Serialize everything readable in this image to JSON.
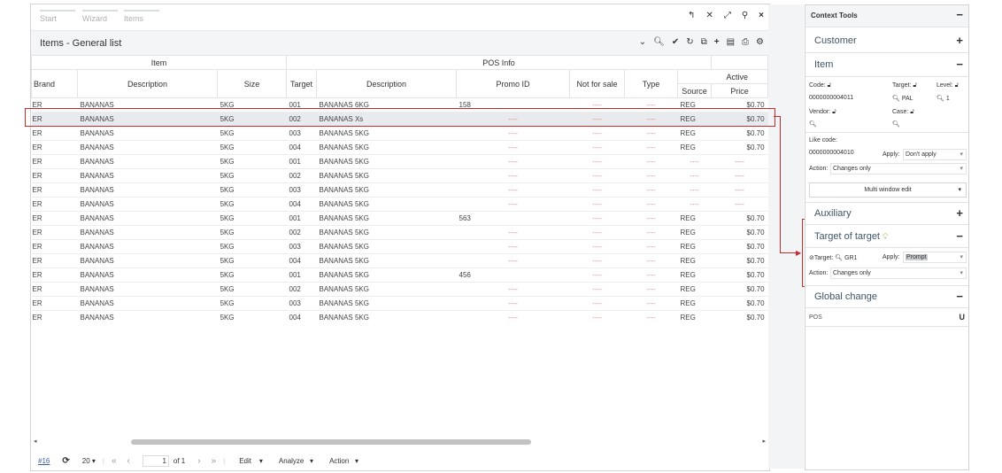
{
  "wizard": {
    "steps": [
      "Start",
      "Wizard",
      "Items"
    ]
  },
  "header": {
    "title": "Items - General list"
  },
  "grid": {
    "groups": [
      "Item",
      "POS Info"
    ],
    "columns": [
      "Brand",
      "Description",
      "Size",
      "Target",
      "Description",
      "Promo ID",
      "Not for sale",
      "Type",
      "Active"
    ],
    "subcolumns": [
      "Source",
      "Price"
    ],
    "rows": [
      [
        "ER",
        "BANANAS",
        "5KG",
        "001",
        "BANANAS 6KG",
        "158",
        "----",
        "----",
        "REG",
        "$0.70"
      ],
      [
        "ER",
        "BANANAS",
        "5KG",
        "002",
        "BANANAS Xs",
        "----",
        "----",
        "----",
        "REG",
        "$0.70"
      ],
      [
        "ER",
        "BANANAS",
        "5KG",
        "003",
        "BANANAS 5KG",
        "----",
        "----",
        "----",
        "REG",
        "$0.70"
      ],
      [
        "ER",
        "BANANAS",
        "5KG",
        "004",
        "BANANAS 5KG",
        "----",
        "----",
        "----",
        "REG",
        "$0.70"
      ],
      [
        "ER",
        "BANANAS",
        "5KG",
        "001",
        "BANANAS 5KG",
        "----",
        "----",
        "----",
        "----",
        "----"
      ],
      [
        "ER",
        "BANANAS",
        "5KG",
        "002",
        "BANANAS 5KG",
        "----",
        "----",
        "----",
        "----",
        "----"
      ],
      [
        "ER",
        "BANANAS",
        "5KG",
        "003",
        "BANANAS 5KG",
        "----",
        "----",
        "----",
        "----",
        "----"
      ],
      [
        "ER",
        "BANANAS",
        "5KG",
        "004",
        "BANANAS 5KG",
        "----",
        "----",
        "----",
        "----",
        "----"
      ],
      [
        "ER",
        "BANANAS",
        "5KG",
        "001",
        "BANANAS 5KG",
        "563",
        "----",
        "----",
        "REG",
        "$0.70"
      ],
      [
        "ER",
        "BANANAS",
        "5KG",
        "002",
        "BANANAS 5KG",
        "----",
        "----",
        "----",
        "REG",
        "$0.70"
      ],
      [
        "ER",
        "BANANAS",
        "5KG",
        "003",
        "BANANAS 5KG",
        "----",
        "----",
        "----",
        "REG",
        "$0.70"
      ],
      [
        "ER",
        "BANANAS",
        "5KG",
        "004",
        "BANANAS 5KG",
        "----",
        "----",
        "----",
        "REG",
        "$0.70"
      ],
      [
        "ER",
        "BANANAS",
        "5KG",
        "001",
        "BANANAS 5KG",
        "456",
        "----",
        "----",
        "REG",
        "$0.70"
      ],
      [
        "ER",
        "BANANAS",
        "5KG",
        "002",
        "BANANAS 5KG",
        "----",
        "----",
        "----",
        "REG",
        "$0.70"
      ],
      [
        "ER",
        "BANANAS",
        "5KG",
        "003",
        "BANANAS 5KG",
        "----",
        "----",
        "----",
        "REG",
        "$0.70"
      ],
      [
        "ER",
        "BANANAS",
        "5KG",
        "004",
        "BANANAS 5KG",
        "----",
        "----",
        "----",
        "REG",
        "$0.70"
      ]
    ],
    "selected_row": 1
  },
  "pager": {
    "count": "#16",
    "page_size": "20",
    "page": "1",
    "of": "of 1",
    "menus": [
      "Edit",
      "Analyze",
      "Action"
    ]
  },
  "context": {
    "title": "Context Tools",
    "sections": {
      "customer": "Customer",
      "item": "Item",
      "auxiliary": "Auxiliary",
      "target": "Target of target",
      "global": "Global change"
    },
    "item": {
      "code_label": "Code:",
      "code_value": "0000000004011",
      "target_label": "Target:",
      "target_value": "PAL",
      "level_label": "Level:",
      "level_value": "1",
      "vendor_label": "Vendor:",
      "case_label": "Case:",
      "like_code_label": "Like code:",
      "like_code_value": "0000000004010",
      "apply_label": "Apply:",
      "apply_value": "Don't apply",
      "action_label": "Action:",
      "action_value": "Changes only",
      "multi_button": "Multi window edit"
    },
    "tot": {
      "target_label": "Target:",
      "target_value": "GR1",
      "apply_label": "Apply:",
      "apply_value": "Prompt",
      "action_label": "Action:",
      "action_value": "Changes only"
    },
    "global": {
      "item": "POS"
    }
  }
}
